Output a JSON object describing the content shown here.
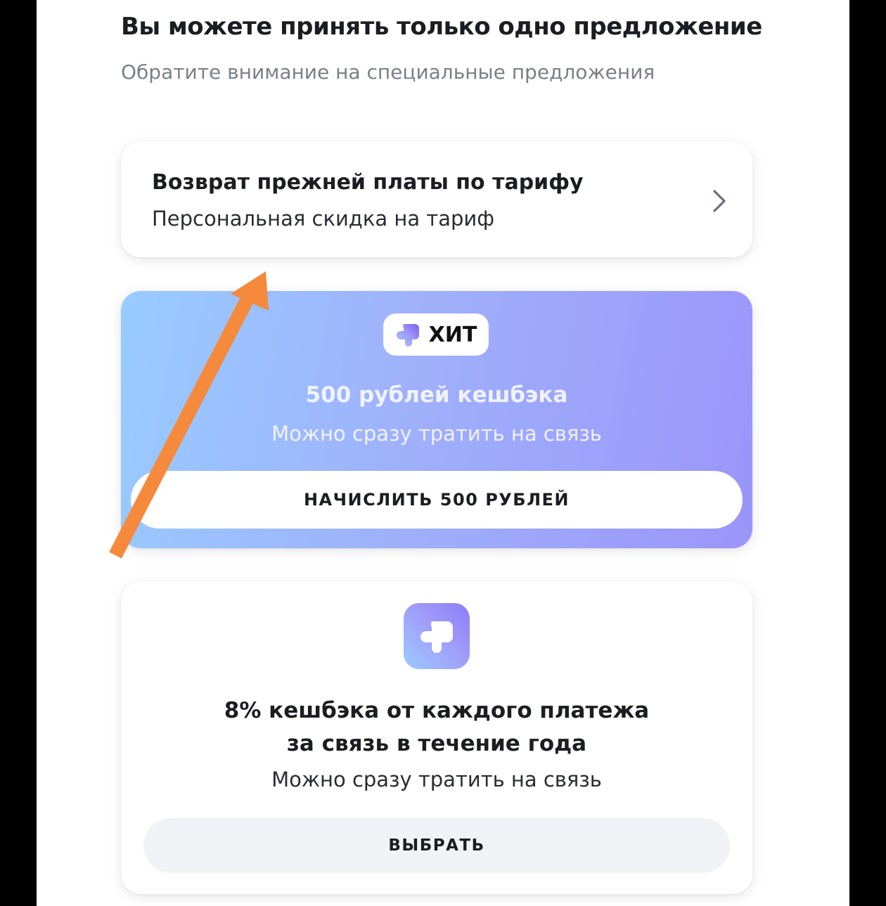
{
  "header": {
    "title": "Вы можете принять только одно предложение",
    "subtitle": "Обратите внимание на специальные предложения"
  },
  "tariff_card": {
    "title": "Возврат прежней платы по тарифу",
    "subtitle": "Персональная скидка на тариф",
    "icon": "chevron-right-icon"
  },
  "hit_card": {
    "badge_label": "ХИТ",
    "title": "500 рублей кешбэка",
    "subtitle": "Можно сразу тратить на связь",
    "button_label": "НАЧИСЛИТЬ 500 РУБЛЕЙ",
    "gradient_colors": [
      "#98ccff",
      "#9fb1fb",
      "#9b95fa"
    ]
  },
  "cashback_card": {
    "title_line1": "8% кешбэка от каждого платежа",
    "title_line2": "за связь в течение года",
    "subtitle": "Можно сразу тратить на связь",
    "button_label": "ВЫБРАТЬ",
    "icon": "plus-logo-icon"
  },
  "annotation": {
    "icon": "orange-arrow-icon",
    "color": "#f58a3c"
  }
}
